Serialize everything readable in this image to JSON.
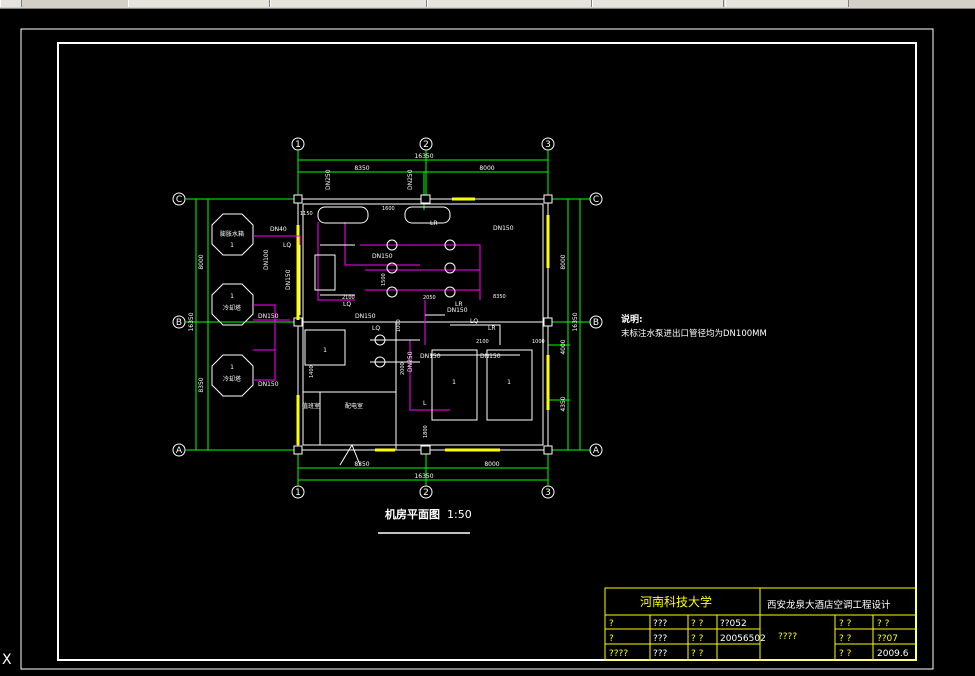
{
  "toolbar": {
    "buttons": [
      "",
      "",
      "",
      "",
      "",
      ""
    ]
  },
  "drawing": {
    "grid_columns": [
      "1",
      "2",
      "3"
    ],
    "grid_rows": [
      "C",
      "B",
      "A"
    ],
    "top_dims": {
      "left": "8350",
      "right": "8000",
      "total": "16350"
    },
    "bottom_dims": {
      "left": "8350",
      "right": "8000",
      "total": "16350"
    },
    "left_dims": {
      "upper": "8000",
      "lower": "8350",
      "total": "16350"
    },
    "right_dims": {
      "upper": "8000",
      "middle": "4000",
      "lower": "4350",
      "total": "16350"
    },
    "tank_labels": {
      "expansion": "膨胀水箱",
      "cooling1": "冷却塔",
      "cooling2": "冷却塔",
      "num": "1"
    },
    "pipe_labels": {
      "dn40": "DN40",
      "dn100": "DN100",
      "dn150": "DN150",
      "dn250": "DN250",
      "lq": "LQ",
      "lr": "LR",
      "l": "L"
    },
    "misc_dims": [
      "1150",
      "1600",
      "2100",
      "2050",
      "8350",
      "1000",
      "2100",
      "1500",
      "1400",
      "1800",
      "2000",
      "1000"
    ],
    "room_labels": {
      "duty": "值班室",
      "office": "配电室"
    },
    "notes_title": "说明:",
    "notes_body": "末标注水泵进出口管径均为DN100MM",
    "plan_title": "机房平面图",
    "plan_scale": "1:50"
  },
  "title_block": {
    "school": "河南科技大学",
    "project": "西安龙泉大酒店空调工程设计",
    "r1": [
      "?",
      "???",
      "? ?",
      "??052"
    ],
    "r2": [
      "?",
      "???",
      "? ?",
      "20056502"
    ],
    "r3": [
      "????",
      "???",
      "? ?"
    ],
    "mid": "????",
    "right": [
      "? ?",
      "? ?",
      "? ?",
      "??07",
      "? ?",
      "2009.6"
    ]
  },
  "cursor": "X",
  "colors": {
    "line": "#ffffff",
    "dim": "#00ff00",
    "pipe": "#ff00ff",
    "wall": "#ffff00",
    "title": "#ffff00"
  }
}
